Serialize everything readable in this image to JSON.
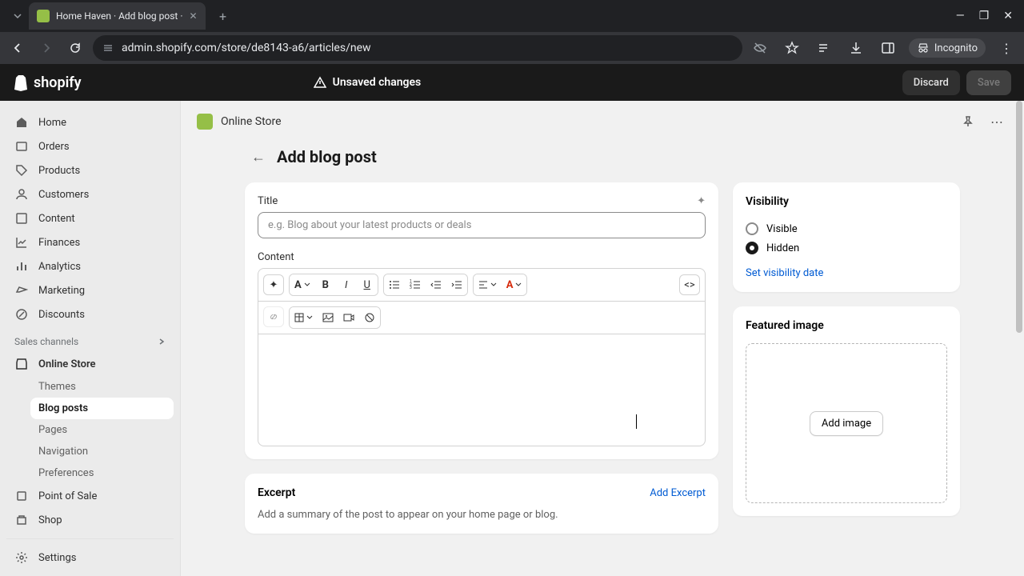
{
  "browser": {
    "tab_title": "Home Haven · Add blog post ·",
    "url": "admin.shopify.com/store/de8143-a6/articles/new",
    "incognito_label": "Incognito"
  },
  "shopify_header": {
    "logo_text": "shopify",
    "unsaved_label": "Unsaved changes",
    "discard_label": "Discard",
    "save_label": "Save"
  },
  "sidebar": {
    "items": [
      {
        "label": "Home"
      },
      {
        "label": "Orders"
      },
      {
        "label": "Products"
      },
      {
        "label": "Customers"
      },
      {
        "label": "Content"
      },
      {
        "label": "Finances"
      },
      {
        "label": "Analytics"
      },
      {
        "label": "Marketing"
      },
      {
        "label": "Discounts"
      }
    ],
    "section_label": "Sales channels",
    "online_store": {
      "label": "Online Store",
      "children": [
        {
          "label": "Themes"
        },
        {
          "label": "Blog posts",
          "active": true
        },
        {
          "label": "Pages"
        },
        {
          "label": "Navigation"
        },
        {
          "label": "Preferences"
        }
      ]
    },
    "pos_label": "Point of Sale",
    "shop_label": "Shop",
    "settings_label": "Settings"
  },
  "breadcrumb": {
    "store_name": "Online Store"
  },
  "page": {
    "title": "Add blog post"
  },
  "title_card": {
    "label": "Title",
    "placeholder": "e.g. Blog about your latest products or deals"
  },
  "content_card": {
    "label": "Content"
  },
  "excerpt_card": {
    "title": "Excerpt",
    "add_link": "Add Excerpt",
    "description": "Add a summary of the post to appear on your home page or blog."
  },
  "visibility_card": {
    "title": "Visibility",
    "visible_label": "Visible",
    "hidden_label": "Hidden",
    "set_date_link": "Set visibility date"
  },
  "featured_image_card": {
    "title": "Featured image",
    "add_button": "Add image"
  }
}
